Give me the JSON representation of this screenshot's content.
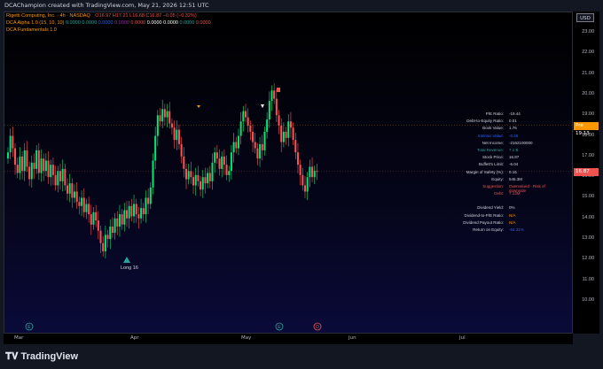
{
  "header": {
    "title": "DCAChampion created with TradingView.com, May 21, 2026 12:51 UTC"
  },
  "legend": {
    "symbol_line": {
      "name": "Rigetti Computing, Inc. · 4h · NASDAQ",
      "ohlc": "O16.97 H17.21 L16.68 C16.87 −0.05 (−0.32%)"
    },
    "dca_alpha": {
      "name": "DCA Alpha 1.0 (15, 10, 10)",
      "values": [
        "0.0000",
        "0.0000",
        "0.0000",
        "0.0000",
        "0.0000",
        "0.0000",
        "0.0000",
        "0.0000",
        "0.0000"
      ],
      "colors": [
        "#26a69a",
        "#26a69a",
        "#2962ff",
        "#9c27b0",
        "#ef5350",
        "#ffffff",
        "#ffffff",
        "#26a69a",
        "#ef5350"
      ]
    },
    "dca_fundamentals": {
      "name": "DCA Fundamentals 1.0"
    }
  },
  "price_axis": {
    "currency": "USD",
    "ticks": [
      "23.00",
      "22.00",
      "21.00",
      "20.00",
      "19.00",
      "18.00",
      "17.00",
      "16.00",
      "15.00",
      "14.00",
      "13.00",
      "12.00",
      "11.00",
      "10.00"
    ],
    "pre_label": "Pre",
    "pre_price": "19.13",
    "last_price": "16.87"
  },
  "time_axis": {
    "labels": [
      "Mar",
      "Apr",
      "May",
      "Jun",
      "Jul"
    ]
  },
  "signals": {
    "long_label": "Long 16"
  },
  "fundamentals_table": [
    {
      "k": "P/E Ratio:",
      "v": "-19.44",
      "kc": "#d1d4dc",
      "vc": "#d1d4dc"
    },
    {
      "k": "Debt-to-Equity Ratio:",
      "v": "0.01",
      "kc": "#d1d4dc",
      "vc": "#d1d4dc"
    },
    {
      "k": "Book Value:",
      "v": "1.76",
      "kc": "#d1d4dc",
      "vc": "#d1d4dc"
    },
    {
      "k": "Intrinsic Value:",
      "v": "-0.25",
      "kc": "#2962ff",
      "vc": "#2962ff"
    },
    {
      "k": "Net Income:",
      "v": "-2162100000",
      "kc": "#d1d4dc",
      "vc": "#d1d4dc"
    },
    {
      "k": "Total Revenue:",
      "v": "7.1 B",
      "kc": "#26a69a",
      "vc": "#26a69a"
    },
    {
      "k": "Stock Price:",
      "v": "16.87",
      "kc": "#d1d4dc",
      "vc": "#d1d4dc"
    },
    {
      "k": "Buffett's Limit:",
      "v": "-6.04",
      "kc": "#d1d4dc",
      "vc": "#d1d4dc"
    },
    {
      "k": "Margin of Safety (%):",
      "v": "0.15",
      "kc": "#d1d4dc",
      "vc": "#d1d4dc"
    },
    {
      "k": "Equity:",
      "v": "546.3M",
      "kc": "#d1d4dc",
      "vc": "#d1d4dc"
    },
    {
      "k": "Suggestion:",
      "v": "Overvalued - Risk of downside",
      "kc": "#ef5350",
      "vc": "#ef5350"
    },
    {
      "k": "Debt:",
      "v": "7.13M",
      "kc": "#ef5350",
      "vc": "#ef5350"
    },
    {
      "k": "",
      "v": "",
      "kc": "#d1d4dc",
      "vc": "#d1d4dc"
    },
    {
      "k": "Dividend Yield:",
      "v": "0%",
      "kc": "#d1d4dc",
      "vc": "#d1d4dc"
    },
    {
      "k": "Dividend-to-P/E Ratio:",
      "v": "N/A",
      "kc": "#d1d4dc",
      "vc": "#ff9800"
    },
    {
      "k": "Dividend Payout Ratio:",
      "v": "N/A",
      "kc": "#d1d4dc",
      "vc": "#ff9800"
    },
    {
      "k": "Return on Equity:",
      "v": "-64.31%",
      "kc": "#d1d4dc",
      "vc": "#2962ff"
    }
  ],
  "footer": {
    "logo_text": "TradingView"
  },
  "colors": {
    "up": "#26a69a",
    "down": "#ef5350",
    "bull_green": "#00e676",
    "bear_red": "#ff5252"
  }
}
